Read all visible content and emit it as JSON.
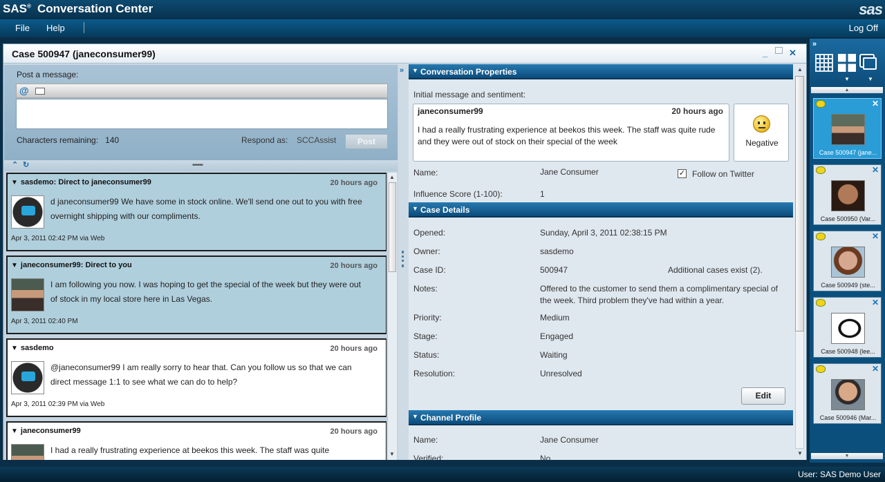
{
  "titlebar": {
    "brand": "SAS",
    "reg": "®",
    "app_name": "Conversation Center",
    "logo": "sas"
  },
  "menubar": {
    "file": "File",
    "help": "Help",
    "logoff": "Log Off"
  },
  "status_bar": {
    "user": "User: SAS Demo User"
  },
  "case_window": {
    "title": "Case 500947 (janeconsumer99)",
    "controls": [
      "minimize-icon",
      "maximize-icon",
      "close-icon"
    ]
  },
  "compose": {
    "label": "Post a message:",
    "input_value": "",
    "chars_label": "Characters remaining:",
    "chars_value": "140",
    "respond_label": "Respond as:",
    "respond_value": "SCCAssist",
    "post_label": "Post"
  },
  "messages": [
    {
      "header": "sasdemo: Direct to janeconsumer99",
      "time": "20 hours ago",
      "body": "d  janeconsumer99 We have some in stock online. We'll send one out to you with free overnight shipping with our compliments.",
      "footer": "Apr 3, 2011 02:42 PM via Web",
      "avatar": "chat-bubble-avatar"
    },
    {
      "header": "janeconsumer99: Direct to you",
      "time": "20 hours ago",
      "body": " I  am following you now.  I  was hoping to get the special of the week but they were out of stock in my local store here in Las Vegas.",
      "footer": "Apr 3, 2011 02:40 PM",
      "avatar": "user-photo"
    },
    {
      "header": "sasdemo",
      "time": "20 hours ago",
      "body": "@janeconsumer99  I  am really sorry to hear that. Can you follow us so that we can direct message 1:1 to see what we can do to help?",
      "footer": "Apr 3, 2011 02:39 PM via Web",
      "avatar": "chat-bubble-avatar"
    },
    {
      "header": "janeconsumer99",
      "time": "20 hours ago",
      "body": " I  had  a  really frustrating experience at beekos this week. The staff was quite",
      "footer": "",
      "avatar": "user-photo"
    }
  ],
  "conversation_properties": {
    "title": "Conversation Properties",
    "initial_label": "Initial message and sentiment:",
    "initial_user": "janeconsumer99",
    "initial_time": "20 hours ago",
    "initial_text": "I had a really frustrating experience at beekos this week.  The staff was quite rude and they were out of stock on their special of the week",
    "sentiment": "Negative",
    "name_label": "Name:",
    "name_value": "Jane Consumer",
    "follow_label": "Follow on Twitter",
    "follow_checked": "✓",
    "influence_label": "Influence Score (1-100):",
    "influence_value": "1"
  },
  "case_details": {
    "title": "Case Details",
    "opened_label": "Opened:",
    "opened_value": "Sunday, April 3, 2011 02:38:15 PM",
    "owner_label": "Owner:",
    "owner_value": "sasdemo",
    "caseid_label": "Case ID:",
    "caseid_value": "500947",
    "additional": "Additional cases exist (2).",
    "notes_label": "Notes:",
    "notes_value": "Offered to the customer to send them a complimentary special of the week.  Third problem they've had within a year.",
    "priority_label": "Priority:",
    "priority_value": "Medium",
    "stage_label": "Stage:",
    "stage_value": "Engaged",
    "status_label": "Status:",
    "status_value": "Waiting",
    "resolution_label": "Resolution:",
    "resolution_value": "Unresolved",
    "edit_label": "Edit"
  },
  "channel_profile": {
    "title": "Channel Profile",
    "name_label": "Name:",
    "name_value": "Jane Consumer",
    "verified_label": "Verified:",
    "verified_value": "No"
  },
  "sidebar": {
    "expand": "»",
    "cases": [
      {
        "label": "Case 500947 (jane...",
        "active": true
      },
      {
        "label": "Case 500950 (Var...",
        "active": false
      },
      {
        "label": "Case 500949 (ste...",
        "active": false
      },
      {
        "label": "Case 500948 (lee...",
        "active": false
      },
      {
        "label": "Case 500946 (Mar...",
        "active": false
      }
    ]
  },
  "colors": {
    "accent": "#0c4c7c",
    "selected_case": "#2a9cd6",
    "message_shade": "#b0cfdd"
  }
}
